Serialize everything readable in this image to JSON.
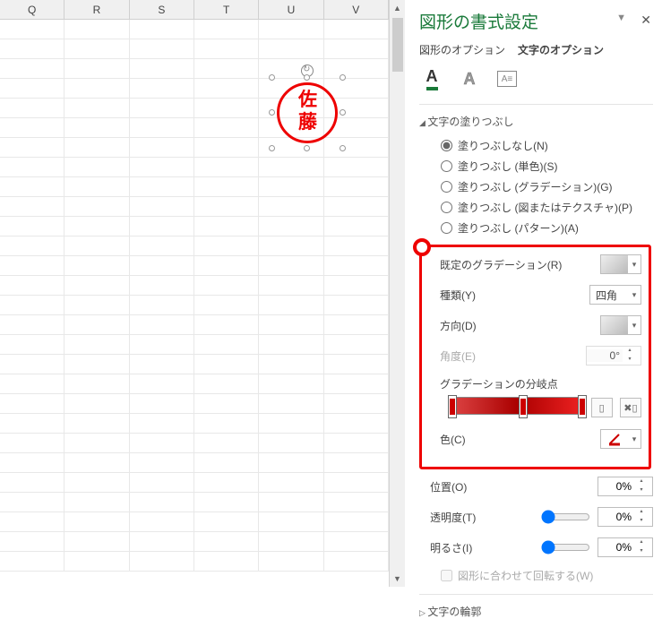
{
  "columns": [
    "Q",
    "R",
    "S",
    "T",
    "U",
    "V"
  ],
  "stamp": "佐藤",
  "panel": {
    "title": "図形の書式設定",
    "tabs": {
      "shape": "図形のオプション",
      "text": "文字のオプション"
    },
    "section_fill": "文字の塗りつぶし",
    "radios": {
      "none": "塗りつぶしなし(N)",
      "solid": "塗りつぶし (単色)(S)",
      "grad": "塗りつぶし (グラデーション)(G)",
      "pic": "塗りつぶし (図またはテクスチャ)(P)",
      "pat": "塗りつぶし (パターン)(A)"
    },
    "labels": {
      "preset": "既定のグラデーション(R)",
      "type": "種類(Y)",
      "dir": "方向(D)",
      "angle": "角度(E)",
      "stops": "グラデーションの分岐点",
      "color": "色(C)",
      "pos": "位置(O)",
      "trans": "透明度(T)",
      "bright": "明るさ(I)",
      "rotate": "図形に合わせて回転する(W)"
    },
    "values": {
      "type": "四角",
      "angle": "0°",
      "pos": "0%",
      "trans": "0%",
      "bright": "0%"
    },
    "section_outline": "文字の輪郭"
  }
}
